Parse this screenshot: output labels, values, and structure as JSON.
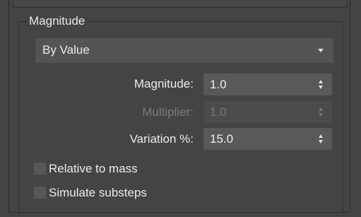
{
  "group": {
    "title": "Magnitude"
  },
  "mode_dropdown": {
    "selected": "By Value"
  },
  "fields": [
    {
      "label": "Magnitude:",
      "value": "1.0",
      "enabled": true
    },
    {
      "label": "Multiplier:",
      "value": "1.0",
      "enabled": false
    },
    {
      "label": "Variation %:",
      "value": "15.0",
      "enabled": true
    }
  ],
  "checkboxes": [
    {
      "label": "Relative to mass",
      "checked": false
    },
    {
      "label": "Simulate substeps",
      "checked": false
    }
  ],
  "colors": {
    "background": "#444444",
    "control": "#595959",
    "text": "#e6e6e6",
    "disabled_text": "#7a7a7a"
  }
}
